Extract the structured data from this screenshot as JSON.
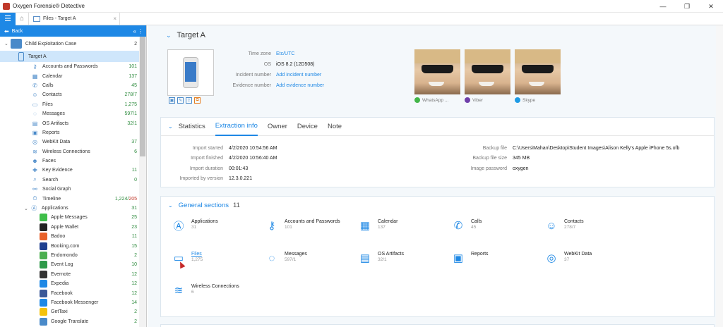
{
  "window": {
    "title": "Oxygen Forensic® Detective",
    "minimize": "—",
    "maximize": "❐",
    "close": "✕"
  },
  "toolbar": {
    "tab_label": "Files - Target A",
    "tab_close": "×"
  },
  "sidebar": {
    "back_label": "Back",
    "case": {
      "label": "Child Exploitation Case",
      "count": "2"
    },
    "device": {
      "label": "Target A"
    },
    "items": [
      {
        "label": "Accounts and Passwords",
        "count": "101",
        "icon": "key-icon"
      },
      {
        "label": "Calendar",
        "count": "137",
        "icon": "calendar-icon"
      },
      {
        "label": "Calls",
        "count": "45",
        "icon": "phone-icon"
      },
      {
        "label": "Contacts",
        "count": "278/7",
        "icon": "contact-icon"
      },
      {
        "label": "Files",
        "count": "1,275",
        "icon": "folder-icon"
      },
      {
        "label": "Messages",
        "count": "597/1",
        "icon": "message-icon"
      },
      {
        "label": "OS Artifacts",
        "count": "32/1",
        "icon": "artifact-icon"
      },
      {
        "label": "Reports",
        "count": "",
        "icon": "report-icon"
      },
      {
        "label": "WebKit Data",
        "count": "37",
        "icon": "webkit-icon"
      },
      {
        "label": "Wireless Connections",
        "count": "6",
        "icon": "wifi-icon"
      },
      {
        "label": "Faces",
        "count": "",
        "icon": "face-icon"
      },
      {
        "label": "Key Evidence",
        "count": "11",
        "icon": "evidence-icon"
      },
      {
        "label": "Search",
        "count": "0",
        "icon": "search-icon"
      },
      {
        "label": "Social Graph",
        "count": "",
        "icon": "graph-icon"
      },
      {
        "label": "Timeline",
        "count": "1,224",
        "count_red": "205",
        "icon": "timeline-icon"
      },
      {
        "label": "Applications",
        "count": "31",
        "icon": "applications-icon"
      }
    ],
    "apps": [
      {
        "label": "Apple Messages",
        "count": "25",
        "color": "#3fbf4a"
      },
      {
        "label": "Apple Wallet",
        "count": "23",
        "color": "#222222"
      },
      {
        "label": "Badoo",
        "count": "11",
        "color": "#e8622c"
      },
      {
        "label": "Booking.com",
        "count": "15",
        "color": "#1f3f8f"
      },
      {
        "label": "Endomondo",
        "count": "2",
        "color": "#4caf50"
      },
      {
        "label": "Event Log",
        "count": "10",
        "color": "#2e9a4a"
      },
      {
        "label": "Evernote",
        "count": "12",
        "color": "#333333"
      },
      {
        "label": "Expedia",
        "count": "12",
        "color": "#1e88e5"
      },
      {
        "label": "Facebook",
        "count": "12",
        "color": "#3b5998"
      },
      {
        "label": "Facebook Messenger",
        "count": "14",
        "color": "#1e88e5"
      },
      {
        "label": "GetTaxi",
        "count": "2",
        "color": "#f4c20d"
      },
      {
        "label": "Google Translate",
        "count": "2",
        "color": "#4a8ac9"
      }
    ]
  },
  "device": {
    "title": "Target A",
    "info": [
      {
        "label": "Time zone",
        "value": "Etc/UTC",
        "link": true
      },
      {
        "label": "OS",
        "value": "iOS 8.2 (12D508)",
        "link": false
      },
      {
        "label": "Incident number",
        "value": "Add incident number",
        "link": true
      },
      {
        "label": "Evidence number",
        "value": "Add evidence number",
        "link": true
      }
    ],
    "photos": [
      {
        "caption": "WhatsApp ...",
        "color": "#43b649"
      },
      {
        "caption": "Viber",
        "color": "#6f3faa"
      },
      {
        "caption": "Skype",
        "color": "#1e9be5"
      }
    ]
  },
  "stats": {
    "tabs": [
      "Statistics",
      "Extraction info",
      "Owner",
      "Device",
      "Note"
    ],
    "active_tab": "Extraction info",
    "left": [
      {
        "k": "Import started",
        "v": "4/2/2020 10:54:56 AM"
      },
      {
        "k": "Import finished",
        "v": "4/2/2020 10:56:40 AM"
      },
      {
        "k": "Import duration",
        "v": "00:01:43"
      },
      {
        "k": "Imported by version",
        "v": "12.3.0.221"
      }
    ],
    "right": [
      {
        "k": "Backup file",
        "v": "C:\\Users\\Mahan\\Desktop\\Student Images\\Alison Kelly's Apple iPhone 5s.ofb"
      },
      {
        "k": "Backup file size",
        "v": "345 MB"
      },
      {
        "k": "Image password",
        "v": "oxygen"
      }
    ]
  },
  "general": {
    "title": "General sections",
    "count": "11",
    "sections": [
      {
        "name": "Applications",
        "count": "31",
        "icon": "applications-icon",
        "glyph": "Ⓐ"
      },
      {
        "name": "Accounts and Passwords",
        "count": "101",
        "icon": "key-icon",
        "glyph": "⚷"
      },
      {
        "name": "Calendar",
        "count": "137",
        "icon": "calendar-icon",
        "glyph": "▦"
      },
      {
        "name": "Calls",
        "count": "45",
        "icon": "phone-icon",
        "glyph": "✆"
      },
      {
        "name": "Contacts",
        "count": "278/7",
        "icon": "contact-icon",
        "glyph": "☺"
      },
      {
        "name": "Files",
        "count": "1,275",
        "icon": "folder-icon",
        "glyph": "▭"
      },
      {
        "name": "Messages",
        "count": "597/1",
        "icon": "message-icon",
        "glyph": "◌"
      },
      {
        "name": "OS Artifacts",
        "count": "32/1",
        "icon": "artifact-icon",
        "glyph": "▤"
      },
      {
        "name": "Reports",
        "count": "",
        "icon": "report-icon",
        "glyph": "▣"
      },
      {
        "name": "WebKit Data",
        "count": "37",
        "icon": "webkit-icon",
        "glyph": "◎"
      },
      {
        "name": "Wireless Connections",
        "count": "6",
        "icon": "wifi-icon",
        "glyph": "≋"
      }
    ]
  }
}
